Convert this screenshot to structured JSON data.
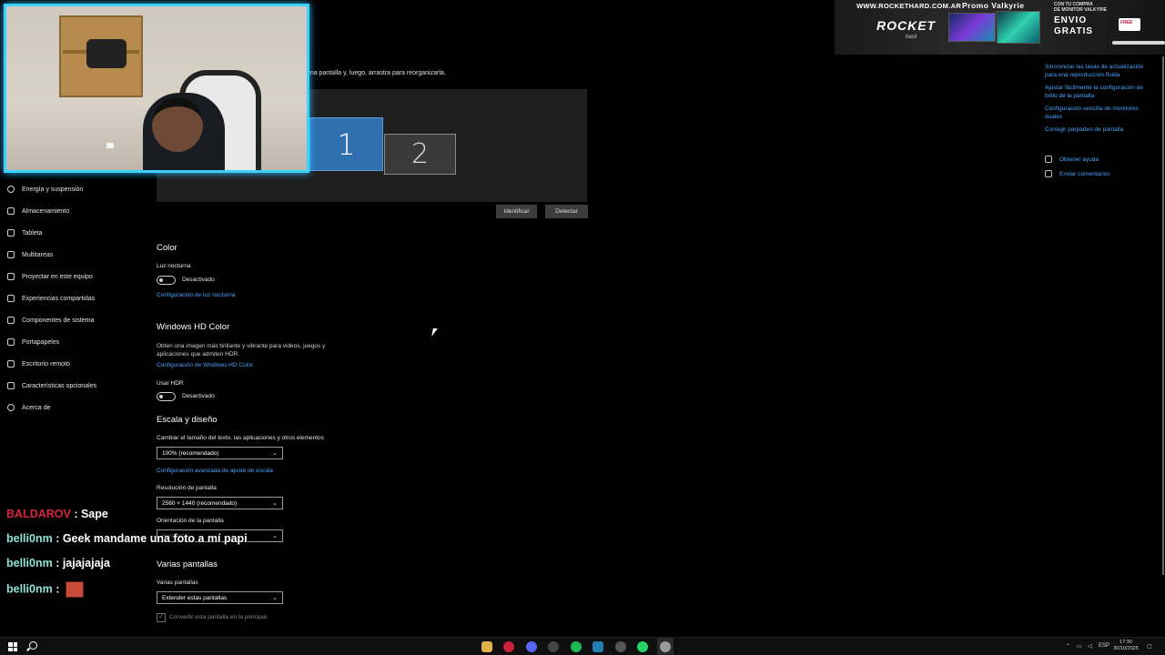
{
  "sidebar": {
    "items": [
      {
        "label": "Energía y suspensión",
        "icon": "power-icon"
      },
      {
        "label": "Almacenamiento",
        "icon": "storage-icon"
      },
      {
        "label": "Tableta",
        "icon": "tablet-icon"
      },
      {
        "label": "Multitareas",
        "icon": "multitasking-icon"
      },
      {
        "label": "Proyectar en este equipo",
        "icon": "project-icon"
      },
      {
        "label": "Experiencias compartidas",
        "icon": "shared-experiences-icon"
      },
      {
        "label": "Componentes de sistema",
        "icon": "system-components-icon"
      },
      {
        "label": "Portapapeles",
        "icon": "clipboard-icon"
      },
      {
        "label": "Escritorio remoto",
        "icon": "remote-desktop-icon"
      },
      {
        "label": "Características opcionales",
        "icon": "optional-features-icon"
      },
      {
        "label": "Acerca de",
        "icon": "info-icon"
      }
    ]
  },
  "display": {
    "intro": "configuración. Mantén presionada (o selecciona) una pantalla y, luego, arrastra para reorganizarla.",
    "monitor1": "1",
    "monitor2": "2",
    "identify_button": "Identificar",
    "detect_button": "Detectar"
  },
  "color": {
    "heading": "Color",
    "night_light_label": "Luz nocturna",
    "night_light_state": "Desactivado",
    "night_light_link": "Configuración de luz nocturna"
  },
  "hdr": {
    "heading": "Windows HD Color",
    "description": "Obtén una imagen más brillante y vibrante para videos, juegos y aplicaciones que admiten HDR.",
    "link": "Configuración de Windows HD Color",
    "use_hdr_label": "Usar HDR",
    "use_hdr_state": "Desactivado"
  },
  "scale": {
    "heading": "Escala y diseño",
    "scale_label": "Cambiar el tamaño del texto, las aplicaciones y otros elementos",
    "scale_value": "100% (recomendado)",
    "advanced_link": "Configuración avanzada de ajuste de escala",
    "resolution_label": "Resolución de pantalla",
    "resolution_value": "2560 × 1440 (recomendado)",
    "orientation_label": "Orientación de la pantalla",
    "orientation_value": "Horizontal"
  },
  "multi": {
    "heading": "Varias pantallas",
    "label": "Varias pantallas",
    "value": "Extender estas pantallas",
    "make_main": "Convertir esta pantalla en la principal"
  },
  "related": {
    "links": [
      "Sincronizar las tasas de actualización para una reproducción fluida",
      "Ajustar fácilmente la configuración de brillo de la pantalla",
      "Configuración sencilla de monitores duales",
      "Corregir parpadeo de pantalla"
    ],
    "help": "Obtener ayuda",
    "feedback": "Enviar comentarios"
  },
  "banner": {
    "url": "WWW.ROCKETHARD.COM.AR",
    "logo": "ROCKET",
    "logo_sub": "hard",
    "promo": "Promo Valkyrie",
    "small_line1": "CON TU COMPRA",
    "small_line2": "DE MONITOR VALKYRIE",
    "envio": "ENVIO",
    "gratis": "GRATIS",
    "truck_text": "FREE"
  },
  "chat": [
    {
      "user": "BALDAROV",
      "message": "Sape",
      "color": "#d9233f"
    },
    {
      "user": "belli0nm",
      "message": "Geek mandame una foto a mí papi",
      "color": "#8fe3d6"
    },
    {
      "user": "belli0nm",
      "message": "jajajajaja",
      "color": "#8fe3d6"
    },
    {
      "user": "belli0nm",
      "message": "",
      "emote": "emote-icon",
      "color": "#8fe3d6"
    }
  ],
  "taskbar": {
    "language": "ESP",
    "time": "17:30",
    "date": "30/10/2025"
  },
  "colors": {
    "accent": "#2f6fb0",
    "link": "#4aa3ff",
    "webcam_border": "#3ad1ff"
  }
}
